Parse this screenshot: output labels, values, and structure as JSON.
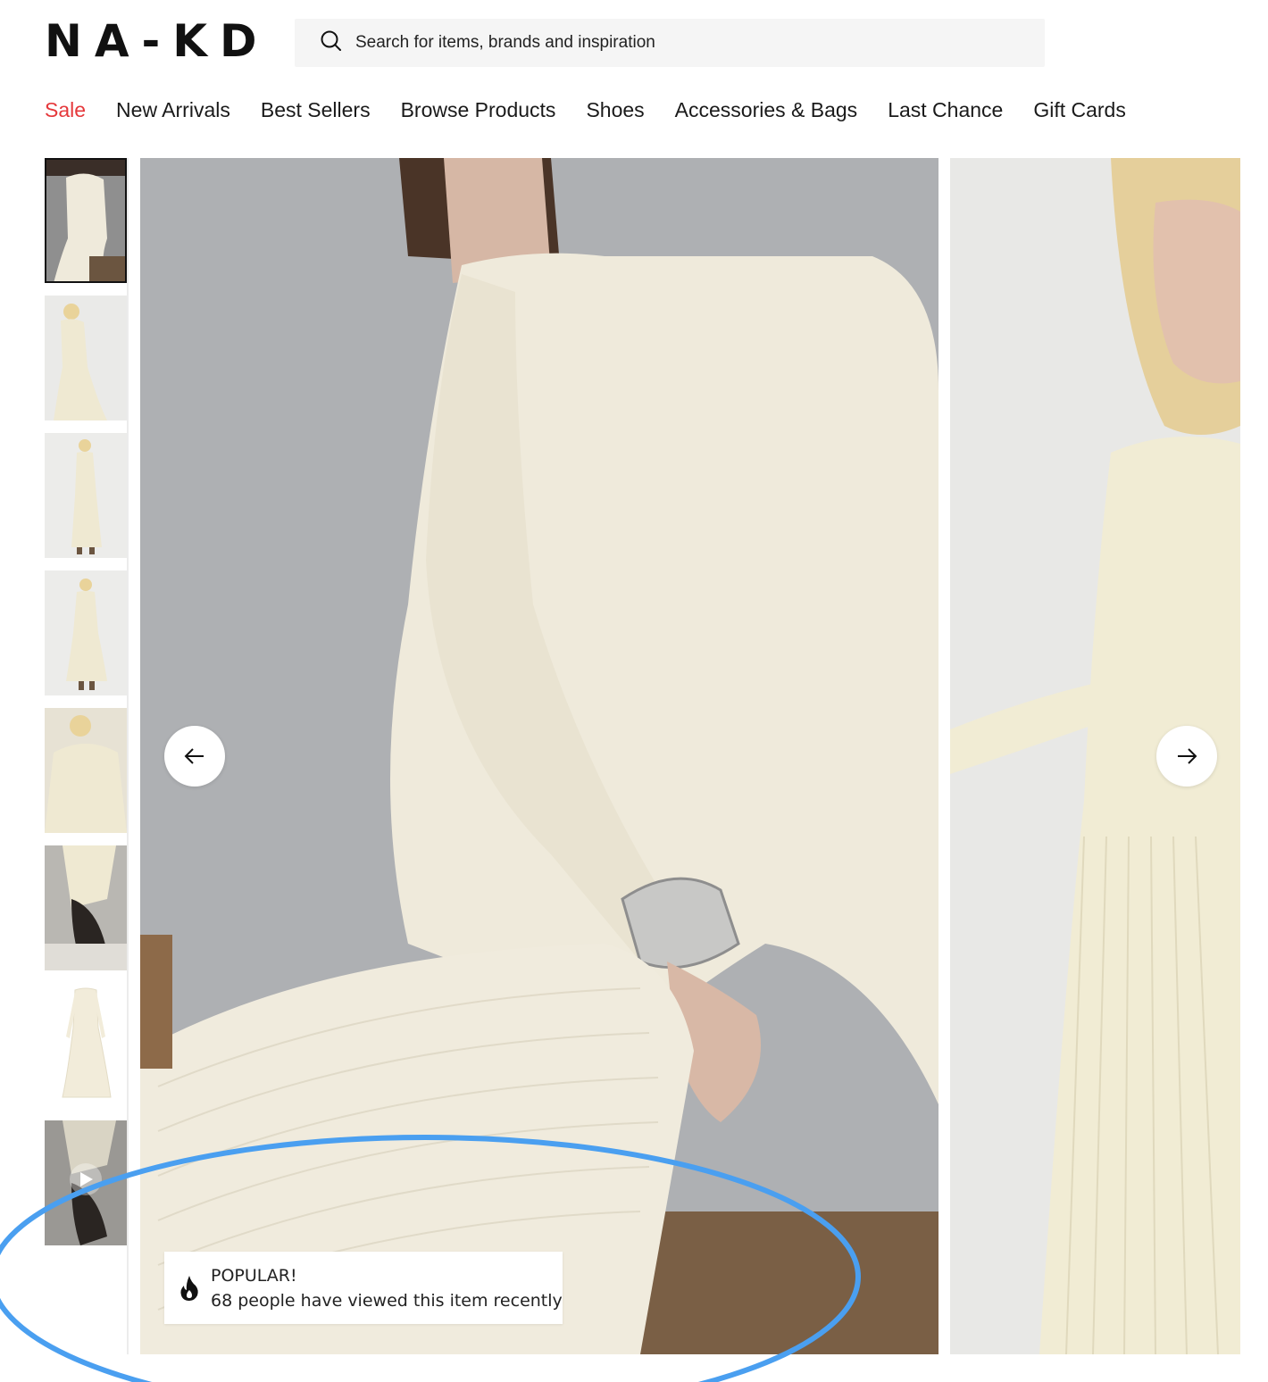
{
  "header": {
    "logo": "NA-KD",
    "search_placeholder": "Search for items, brands and inspiration"
  },
  "nav": {
    "items": [
      {
        "label": "Sale",
        "color": "#e5383b"
      },
      {
        "label": "New Arrivals"
      },
      {
        "label": "Best Sellers"
      },
      {
        "label": "Browse Products"
      },
      {
        "label": "Shoes"
      },
      {
        "label": "Accessories & Bags"
      },
      {
        "label": "Last Chance"
      },
      {
        "label": "Gift Cards"
      }
    ]
  },
  "gallery": {
    "thumbnail_count": 8,
    "selected_index": 0,
    "popular_badge": {
      "title": "POPULAR!",
      "message": "68 people have viewed this item recently",
      "icon": "flame-icon"
    }
  },
  "annotation": {
    "highlight_color": "#4a9ff0"
  }
}
